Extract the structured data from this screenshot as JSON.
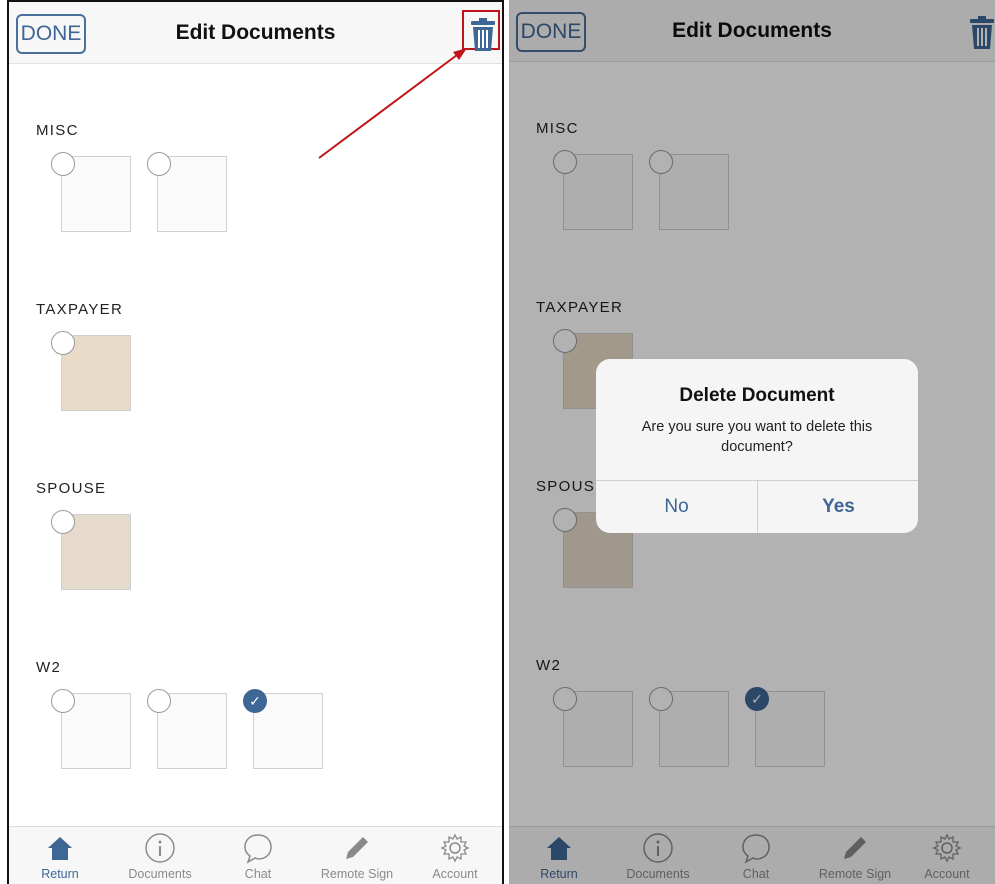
{
  "nav": {
    "done_label": "DONE",
    "title": "Edit Documents"
  },
  "sections": [
    {
      "label": "MISC",
      "thumbs": 2,
      "checked": []
    },
    {
      "label": "TAXPAYER",
      "thumbs": 1,
      "checked": []
    },
    {
      "label": "SPOUSE",
      "thumbs": 1,
      "checked": []
    },
    {
      "label": "W2",
      "thumbs": 3,
      "checked": [
        2
      ]
    }
  ],
  "tabs": [
    {
      "label": "Return",
      "icon": "home-icon",
      "active": true
    },
    {
      "label": "Documents",
      "icon": "info-icon",
      "active": false
    },
    {
      "label": "Chat",
      "icon": "chat-bubble-icon",
      "active": false
    },
    {
      "label": "Remote Sign",
      "icon": "pencil-icon",
      "active": false
    },
    {
      "label": "Account",
      "icon": "gear-icon",
      "active": false
    }
  ],
  "dialog": {
    "title": "Delete Document",
    "message": "Are you sure you want to delete this document?",
    "no_label": "No",
    "yes_label": "Yes"
  },
  "colors": {
    "accent": "#3e6796",
    "highlight": "#c0141a"
  }
}
